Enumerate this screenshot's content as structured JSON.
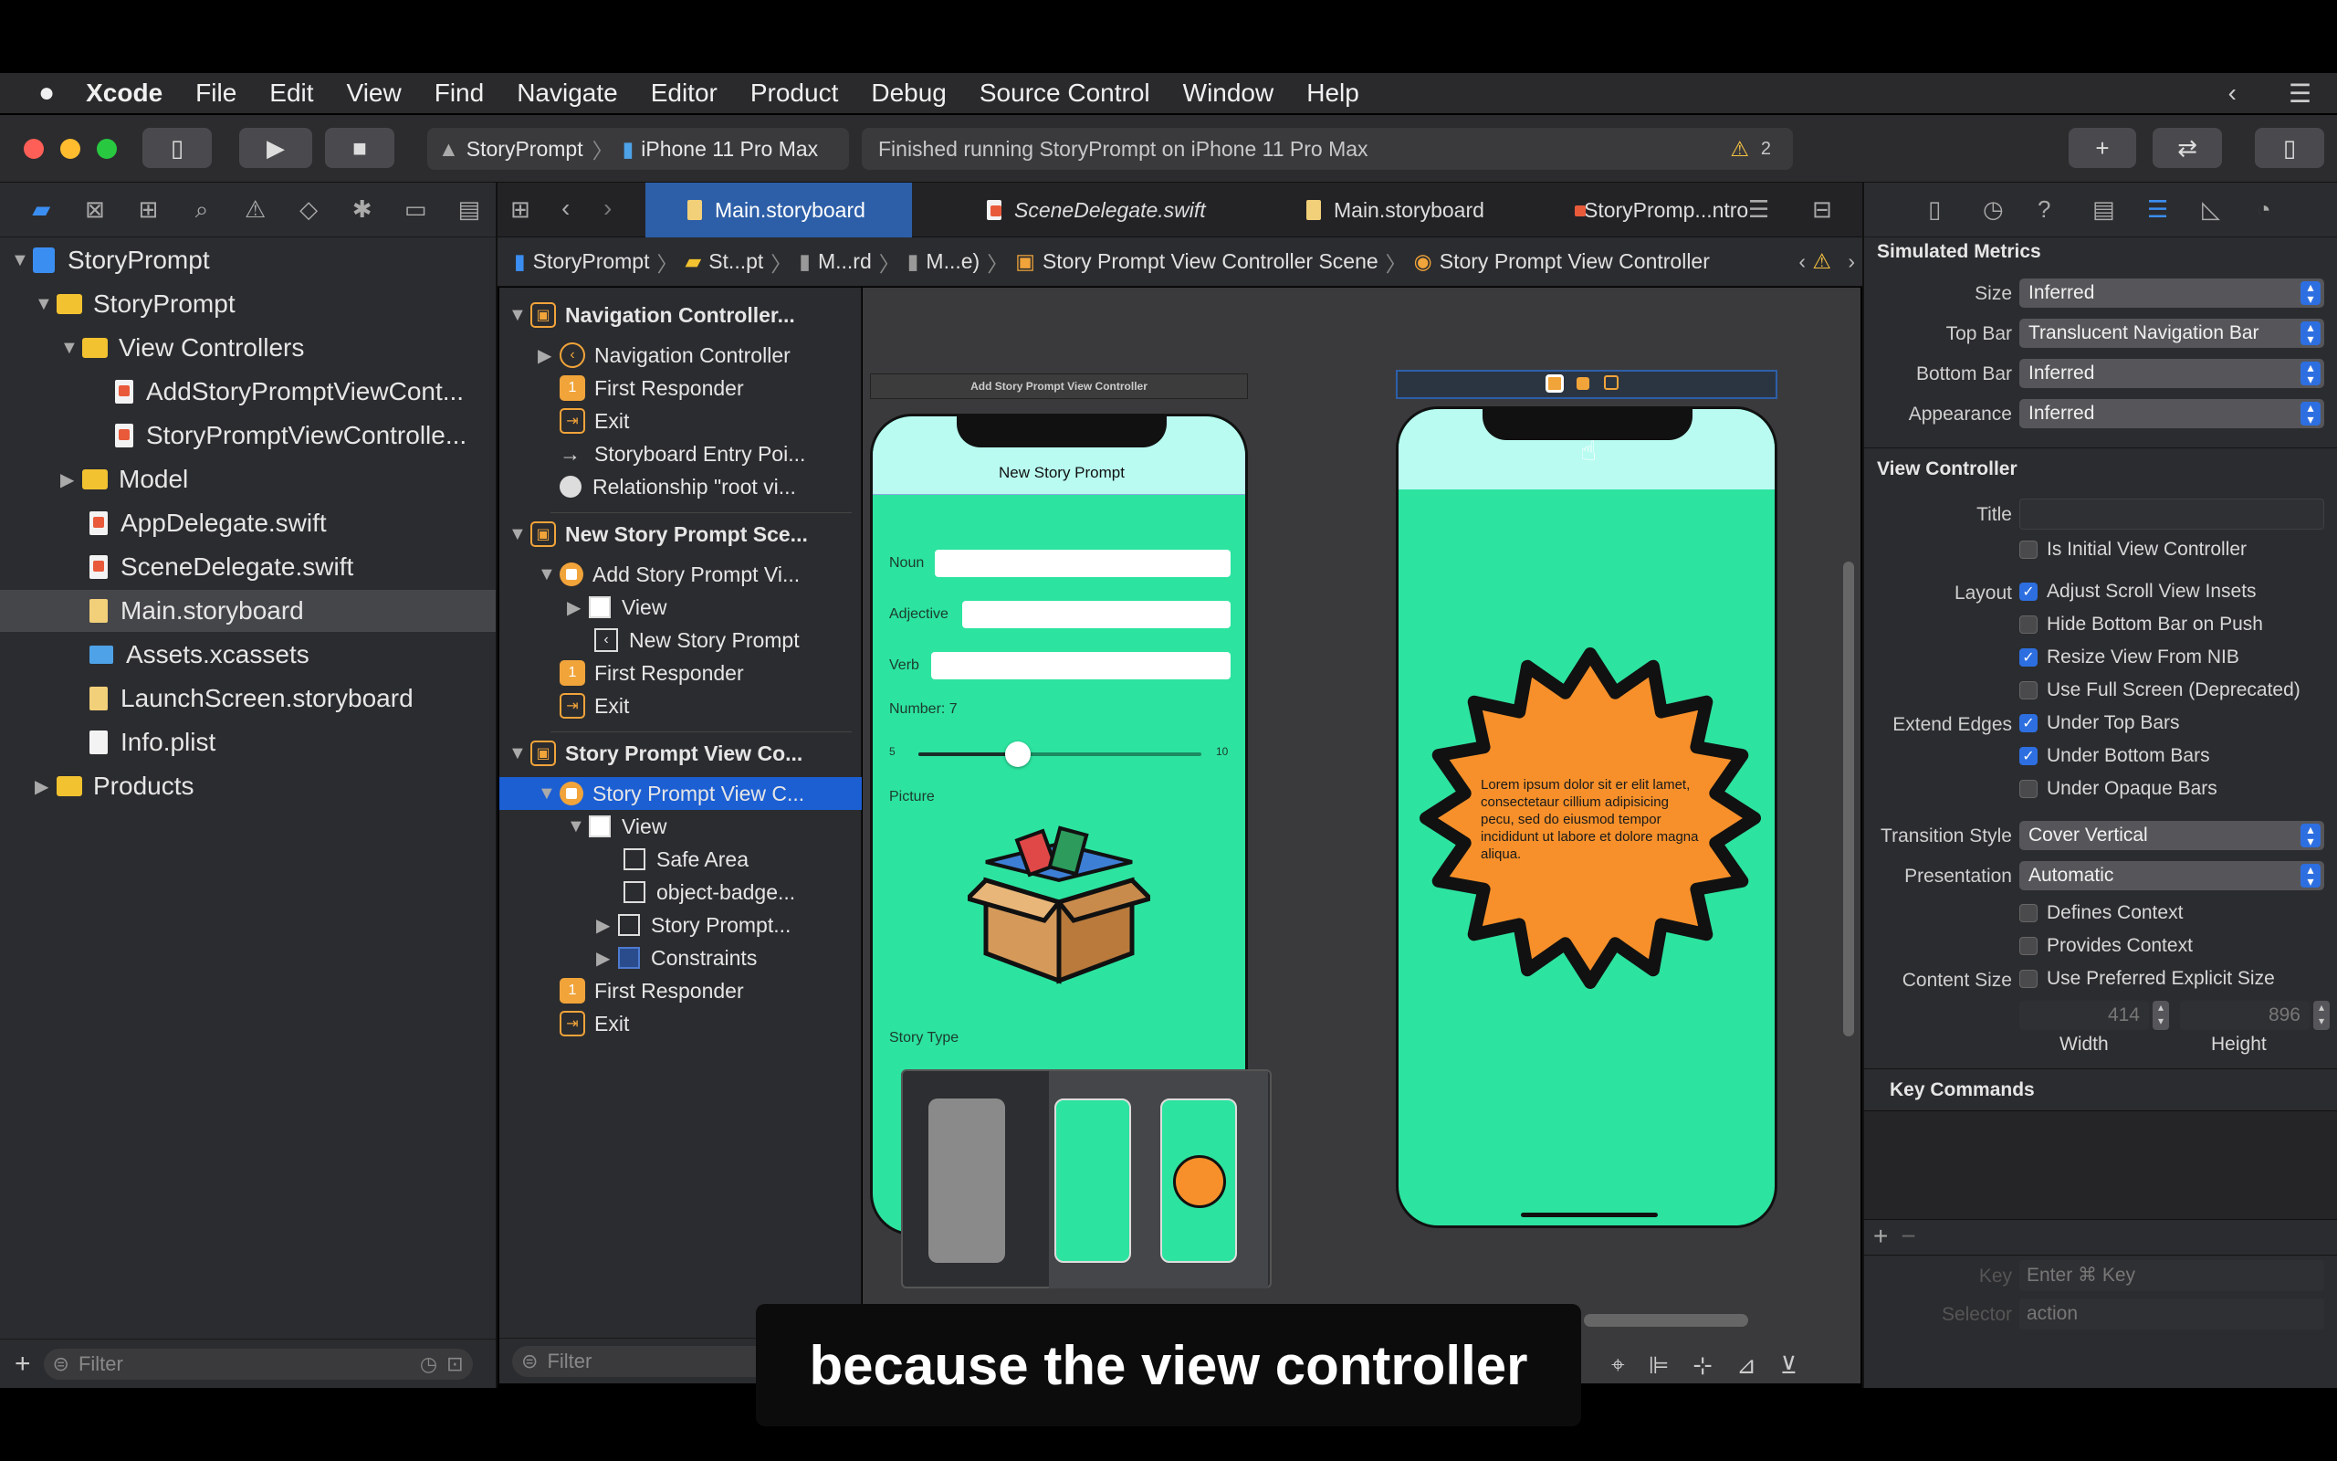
{
  "menubar": {
    "app": "Xcode",
    "items": [
      "File",
      "Edit",
      "View",
      "Find",
      "Navigate",
      "Editor",
      "Product",
      "Debug",
      "Source Control",
      "Window",
      "Help"
    ]
  },
  "toolbar": {
    "scheme": "StoryPrompt",
    "device": "iPhone 11 Pro Max",
    "status": "Finished running StoryPrompt on iPhone 11 Pro Max",
    "warning_count": "2"
  },
  "navigator": {
    "items": [
      {
        "label": "StoryPrompt",
        "kind": "project"
      },
      {
        "label": "StoryPrompt",
        "kind": "folder"
      },
      {
        "label": "View Controllers",
        "kind": "folder"
      },
      {
        "label": "AddStoryPromptViewCont...",
        "kind": "swift"
      },
      {
        "label": "StoryPromptViewControlle...",
        "kind": "swift"
      },
      {
        "label": "Model",
        "kind": "folder"
      },
      {
        "label": "AppDelegate.swift",
        "kind": "swift"
      },
      {
        "label": "SceneDelegate.swift",
        "kind": "swift"
      },
      {
        "label": "Main.storyboard",
        "kind": "storyboard",
        "selected": true
      },
      {
        "label": "Assets.xcassets",
        "kind": "assets"
      },
      {
        "label": "LaunchScreen.storyboard",
        "kind": "storyboard"
      },
      {
        "label": "Info.plist",
        "kind": "plist"
      },
      {
        "label": "Products",
        "kind": "folder"
      }
    ],
    "filter_placeholder": "Filter"
  },
  "tabs": [
    "Main.storyboard",
    "SceneDelegate.swift",
    "Main.storyboard",
    "StoryPromp...ntro"
  ],
  "breadcrumb": [
    "StoryPrompt",
    "St...pt",
    "M...rd",
    "M...e)",
    "Story Prompt View Controller Scene",
    "Story Prompt View Controller"
  ],
  "outline": {
    "rows": [
      {
        "label": "Navigation Controller...",
        "type": "scene"
      },
      {
        "label": "Navigation Controller",
        "type": "nav"
      },
      {
        "label": "First Responder",
        "type": "responder"
      },
      {
        "label": "Exit",
        "type": "exit"
      },
      {
        "label": "Storyboard Entry Poi...",
        "type": "arrow"
      },
      {
        "label": "Relationship \"root vi...",
        "type": "relationship"
      },
      {
        "label": "New Story Prompt Sce...",
        "type": "scene"
      },
      {
        "label": "Add Story Prompt Vi...",
        "type": "vc"
      },
      {
        "label": "View",
        "type": "view"
      },
      {
        "label": "New Story Prompt",
        "type": "navitem"
      },
      {
        "label": "First Responder",
        "type": "responder"
      },
      {
        "label": "Exit",
        "type": "exit"
      },
      {
        "label": "Story Prompt View Co...",
        "type": "scene"
      },
      {
        "label": "Story Prompt View C...",
        "type": "vc",
        "selected": true
      },
      {
        "label": "View",
        "type": "view"
      },
      {
        "label": "Safe Area",
        "type": "safe"
      },
      {
        "label": "object-badge...",
        "type": "image"
      },
      {
        "label": "Story Prompt...",
        "type": "text"
      },
      {
        "label": "Constraints",
        "type": "constraints"
      },
      {
        "label": "First Responder",
        "type": "responder"
      },
      {
        "label": "Exit",
        "type": "exit"
      }
    ],
    "filter_placeholder": "Filter"
  },
  "canvas": {
    "left_scene_title": "Add Story Prompt View Controller",
    "left_nav_title": "New Story Prompt",
    "fields": [
      "Noun",
      "Adjective",
      "Verb"
    ],
    "number_label": "Number: 7",
    "slider_min": "5",
    "slider_max": "10",
    "slider_value": 0.35,
    "picture_label": "Picture",
    "story_type_label": "Story Type",
    "lorem": "Lorem ipsum dolor sit er elit lamet, consectetaur cillium adipisicing pecu, sed do eiusmod tempor incididunt ut labore et dolore magna aliqua."
  },
  "inspector": {
    "simulated_metrics_title": "Simulated Metrics",
    "size_label": "Size",
    "size_value": "Inferred",
    "topbar_label": "Top Bar",
    "topbar_value": "Translucent Navigation Bar",
    "bottombar_label": "Bottom Bar",
    "bottombar_value": "Inferred",
    "appearance_label": "Appearance",
    "appearance_value": "Inferred",
    "vc_title": "View Controller",
    "title_label": "Title",
    "is_initial": "Is Initial View Controller",
    "layout_label": "Layout",
    "adjust_scroll": "Adjust Scroll View Insets",
    "hide_bottom": "Hide Bottom Bar on Push",
    "resize_nib": "Resize View From NIB",
    "full_screen": "Use Full Screen (Deprecated)",
    "extend_label": "Extend Edges",
    "under_top": "Under Top Bars",
    "under_bottom": "Under Bottom Bars",
    "under_opaque": "Under Opaque Bars",
    "transition_label": "Transition Style",
    "transition_value": "Cover Vertical",
    "presentation_label": "Presentation",
    "presentation_value": "Automatic",
    "defines_context": "Defines Context",
    "provides_context": "Provides Context",
    "content_size_label": "Content Size",
    "preferred_size": "Use Preferred Explicit Size",
    "width_value": "414",
    "height_value": "896",
    "width_label": "Width",
    "height_label": "Height",
    "key_commands_title": "Key Commands",
    "key_label": "Key",
    "key_placeholder": "Enter ⌘ Key",
    "selector_label": "Selector",
    "selector_placeholder": "action"
  },
  "caption": "because the view controller",
  "colors": {
    "accent": "#2d6fe0",
    "canvas_bg": "#2de3a0",
    "badge": "#f7902a",
    "navbar": "#b9fbf1"
  }
}
